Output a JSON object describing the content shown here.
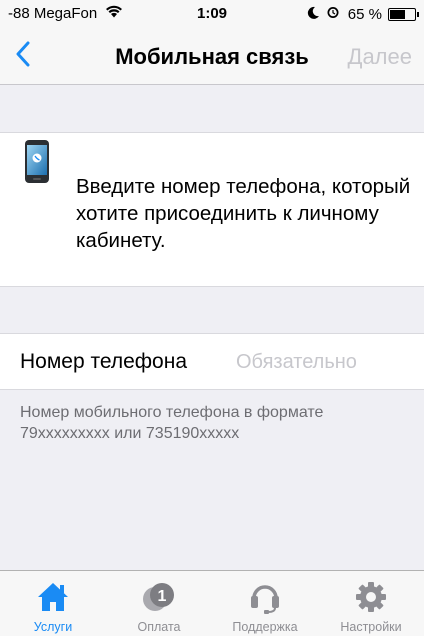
{
  "status_bar": {
    "carrier": "-88 MegaFon",
    "time": "1:09",
    "battery_percent": "65 %",
    "battery_level": 0.65
  },
  "nav": {
    "title": "Мобильная связь",
    "next_label": "Далее",
    "back_icon": "chevron-left-icon"
  },
  "info": {
    "message": "Введите номер телефона, который хотите присоединить к личному кабинету.",
    "icon": "phone-icon"
  },
  "form": {
    "phone_label": "Номер телефона",
    "phone_placeholder": "Обязательно",
    "phone_value": "",
    "hint": "Номер мобильного телефона в формате 79xxxxxxxxx или 735190xxxxx"
  },
  "tabs": [
    {
      "label": "Услуги",
      "icon": "home-icon",
      "active": true
    },
    {
      "label": "Оплата",
      "icon": "payment-icon",
      "active": false
    },
    {
      "label": "Поддержка",
      "icon": "headset-icon",
      "active": false
    },
    {
      "label": "Настройки",
      "icon": "gear-icon",
      "active": false
    }
  ],
  "colors": {
    "accent": "#1a8bf4",
    "inactive": "#8e8e93",
    "placeholder": "#c7c7cc",
    "background": "#efeff4"
  }
}
